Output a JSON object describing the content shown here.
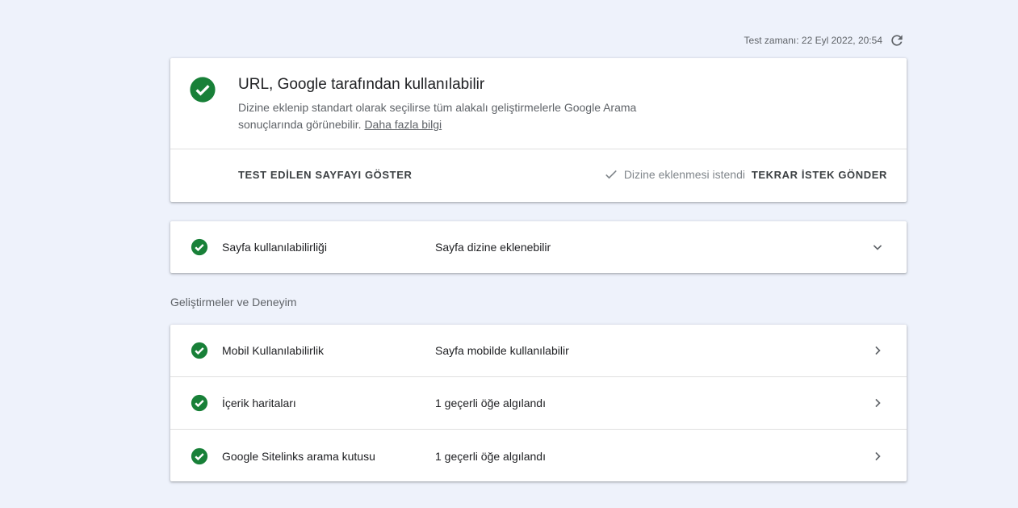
{
  "header": {
    "test_time": "Test zamanı: 22 Eyl 2022, 20:54",
    "refresh_icon": "refresh-icon"
  },
  "summary": {
    "status_icon": "check-circle-icon",
    "title": "URL, Google tarafından kullanılabilir",
    "description": "Dizine eklenip standart olarak seçilirse tüm alakalı geliştirmelerle Google Arama sonuçlarında görünebilir.",
    "learn_more": "Daha fazla bilgi",
    "show_page_button": "TEST EDİLEN SAYFAYI GÖSTER",
    "indexing_requested": "Dizine eklenmesi istendi",
    "resend_button": "TEKRAR İSTEK GÖNDER"
  },
  "availability": {
    "label": "Sayfa kullanılabilirliği",
    "value": "Sayfa dizine eklenebilir"
  },
  "enhancements": {
    "heading": "Geliştirmeler ve Deneyim",
    "items": [
      {
        "label": "Mobil Kullanılabilirlik",
        "value": "Sayfa mobilde kullanılabilir"
      },
      {
        "label": "İçerik haritaları",
        "value": "1 geçerli öğe algılandı"
      },
      {
        "label": "Google Sitelinks arama kutusu",
        "value": "1 geçerli öğe algılandı"
      }
    ]
  },
  "colors": {
    "success_green": "#188038",
    "background": "#eef2fb"
  }
}
